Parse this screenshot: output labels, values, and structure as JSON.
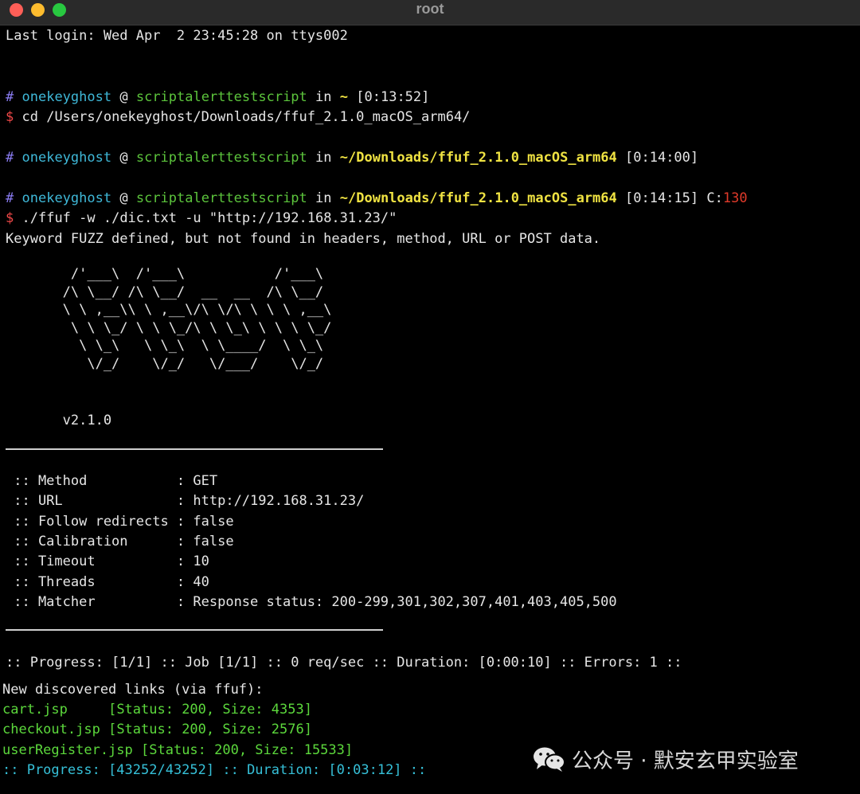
{
  "window": {
    "title": "root"
  },
  "lines": {
    "login": "Last login: Wed Apr  2 23:45:28 on ttys002",
    "p1": {
      "hash": "#",
      "user": "onekeyghost",
      "at": "@",
      "host": "scriptalerttestscript",
      "in": "in",
      "path": "~",
      "time": "[0:13:52]"
    },
    "cmd1": {
      "dollar": "$",
      "text": "cd /Users/onekeyghost/Downloads/ffuf_2.1.0_macOS_arm64/"
    },
    "p2": {
      "hash": "#",
      "user": "onekeyghost",
      "at": "@",
      "host": "scriptalerttestscript",
      "in": "in",
      "path": "~/Downloads/ffuf_2.1.0_macOS_arm64",
      "time": "[0:14:00]"
    },
    "p3": {
      "hash": "#",
      "user": "onekeyghost",
      "at": "@",
      "host": "scriptalerttestscript",
      "in": "in",
      "path": "~/Downloads/ffuf_2.1.0_macOS_arm64",
      "time": "[0:14:15]",
      "code_label": "C:",
      "code": "130"
    },
    "cmd2": {
      "dollar": "$",
      "text": "./ffuf -w ./dic.txt -u \"http://192.168.31.23/\""
    },
    "warning": "Keyword FUZZ defined, but not found in headers, method, URL or POST data."
  },
  "banner": "        /'___\\  /'___\\           /'___\\\n       /\\ \\__/ /\\ \\__/  __  __  /\\ \\__/\n       \\ \\ ,__\\\\ \\ ,__\\/\\ \\/\\ \\ \\ \\ ,__\\\n        \\ \\ \\_/ \\ \\ \\_/\\ \\ \\_\\ \\ \\ \\ \\_/\n         \\ \\_\\   \\ \\_\\  \\ \\____/  \\ \\_\\\n          \\/_/    \\/_/   \\/___/    \\/_/",
  "version": "v2.1.0",
  "config": [
    " :: Method           : GET",
    " :: URL              : http://192.168.31.23/",
    " :: Follow redirects : false",
    " :: Calibration      : false",
    " :: Timeout          : 10",
    " :: Threads          : 40",
    " :: Matcher          : Response status: 200-299,301,302,307,401,403,405,500"
  ],
  "progress_line": ":: Progress: [1/1] :: Job [1/1] :: 0 req/sec :: Duration: [0:00:10] :: Errors: 1 ::",
  "discovered": {
    "header": "New discovered links (via ffuf):",
    "links": [
      {
        "name": "cart.jsp",
        "status": "[Status: 200, Size: 4353]"
      },
      {
        "name": "checkout.jsp",
        "status": "[Status: 200, Size: 2576]"
      },
      {
        "name": "userRegister.jsp",
        "status": "[Status: 200, Size: 15533]"
      }
    ],
    "final": {
      "prefix": ":: Progress: ",
      "count": "[43252/43252]",
      "mid": " :: Duration: ",
      "duration": "[0:03:12]",
      "suffix": " ::"
    }
  },
  "watermark": {
    "text": "公众号 · 默安玄甲实验室",
    "icon": "wechat-icon"
  },
  "colors": {
    "traffic_red": "#ff5f57",
    "traffic_yellow": "#febc2e",
    "traffic_green": "#28c840",
    "prompt_hash": "#8a7cf2",
    "prompt_user": "#3fb8d8",
    "prompt_host": "#5cc43c",
    "prompt_path": "#f0e342",
    "dollar": "#f04848",
    "exit_code": "#e03a2a",
    "link_green": "#5cd83c",
    "progress_cyan": "#36c0d8"
  }
}
